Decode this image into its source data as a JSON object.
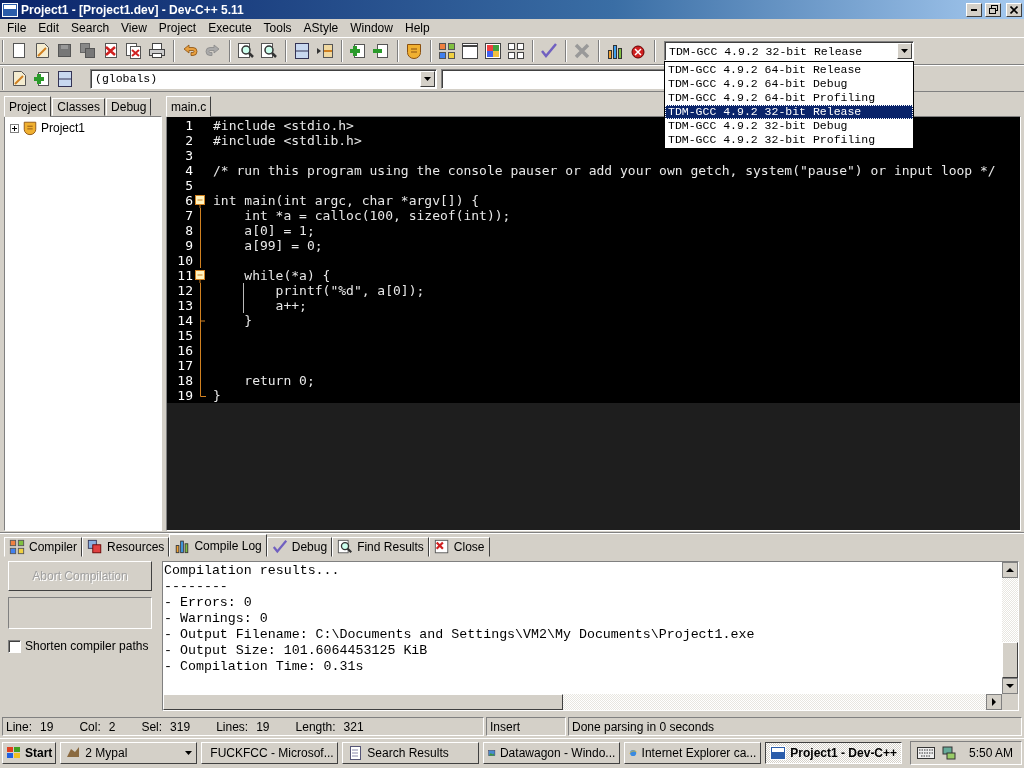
{
  "window": {
    "title": "Project1 - [Project1.dev] - Dev-C++ 5.11"
  },
  "menu": [
    "File",
    "Edit",
    "Search",
    "View",
    "Project",
    "Execute",
    "Tools",
    "AStyle",
    "Window",
    "Help"
  ],
  "compiler_select": {
    "value": "TDM-GCC 4.9.2 32-bit Release",
    "expanded": true,
    "options": [
      {
        "label": "TDM-GCC 4.9.2 64-bit Release",
        "selected": false
      },
      {
        "label": "TDM-GCC 4.9.2 64-bit Debug",
        "selected": false
      },
      {
        "label": "TDM-GCC 4.9.2 64-bit Profiling",
        "selected": false
      },
      {
        "label": "TDM-GCC 4.9.2 32-bit Release",
        "selected": true
      },
      {
        "label": "TDM-GCC 4.9.2 32-bit Debug",
        "selected": false
      },
      {
        "label": "TDM-GCC 4.9.2 32-bit Profiling",
        "selected": false
      }
    ]
  },
  "scope_select": {
    "value": "(globals)"
  },
  "side_tabs": [
    {
      "label": "Project",
      "selected": true
    },
    {
      "label": "Classes",
      "selected": false
    },
    {
      "label": "Debug",
      "selected": false
    }
  ],
  "project_tree": [
    {
      "label": "Project1",
      "expanded": false
    }
  ],
  "editor_tabs": [
    {
      "label": "main.c",
      "selected": true
    }
  ],
  "code_lines": [
    {
      "number": "1",
      "text": "#include <stdio.h>",
      "kind": "plain"
    },
    {
      "number": "2",
      "text": "#include <stdlib.h>",
      "kind": "plain"
    },
    {
      "number": "3",
      "kind": "plain"
    },
    {
      "number": "4",
      "text": "/* run this program using the console pauser or add your own getch, system(\"pause\") or input loop */",
      "kind": "plain"
    },
    {
      "number": "5",
      "kind": "plain"
    },
    {
      "number": "6",
      "text": "int main(int argc, char *argv[]) {",
      "kind": "foldstart"
    },
    {
      "number": "7",
      "text": "    int *a = calloc(100, sizeof(int));",
      "kind": "foldbody"
    },
    {
      "number": "8",
      "text": "    a[0] = 1;",
      "kind": "foldbody"
    },
    {
      "number": "9",
      "text": "    a[99] = 0;",
      "kind": "foldbody"
    },
    {
      "number": "10",
      "kind": "foldbody"
    },
    {
      "number": "11",
      "text": "    while(*a) {",
      "kind": "foldstart"
    },
    {
      "number": "12",
      "text": "        printf(\"%d\", a[0]);",
      "kind": "foldbody",
      "guide": true
    },
    {
      "number": "13",
      "text": "        a++;",
      "kind": "foldbody",
      "guide": true
    },
    {
      "number": "14",
      "text": "    }",
      "kind": "foldtick"
    },
    {
      "number": "15",
      "kind": "foldbody"
    },
    {
      "number": "16",
      "kind": "foldbody"
    },
    {
      "number": "17",
      "kind": "foldbody"
    },
    {
      "number": "18",
      "text": "    return 0;",
      "kind": "foldbody"
    },
    {
      "number": "19",
      "text": "}",
      "kind": "foldend"
    }
  ],
  "bottom_tabs": [
    {
      "label": "Compiler",
      "selected": false,
      "kind": "grid"
    },
    {
      "label": "Resources",
      "selected": false,
      "kind": "layers"
    },
    {
      "label": "Compile Log",
      "selected": true,
      "kind": "chart"
    },
    {
      "label": "Debug",
      "selected": false,
      "kind": "check"
    },
    {
      "label": "Find Results",
      "selected": false,
      "kind": "find"
    },
    {
      "label": "Close",
      "selected": false,
      "kind": "close"
    }
  ],
  "compiler_panel": {
    "abort_button": {
      "label": "Abort Compilation",
      "disabled": true
    },
    "shorten_paths": {
      "label": "Shorten compiler paths",
      "checked": false
    }
  },
  "compile_log": [
    "Compilation results...",
    "--------",
    "- Errors: 0",
    "- Warnings: 0",
    "- Output Filename: C:\\Documents and Settings\\VM2\\My Documents\\Project1.exe",
    "- Output Size: 101.6064453125 KiB",
    "- Compilation Time: 0.31s"
  ],
  "status_bar": {
    "fields": [
      {
        "label": "Line:",
        "value": "19"
      },
      {
        "label": "Col:",
        "value": "2"
      },
      {
        "label": "Sel:",
        "value": "319"
      },
      {
        "label": "Lines:",
        "value": "19"
      },
      {
        "label": "Length:",
        "value": "321"
      }
    ],
    "mode": "Insert",
    "message": "Done parsing in 0 seconds"
  },
  "taskbar": {
    "start": "Start",
    "items": [
      {
        "label": "2 Mypal",
        "selected": false,
        "kind": "group"
      },
      {
        "label": "FUCKFCC - Microsof...",
        "selected": false,
        "kind": "app"
      },
      {
        "label": "Search Results",
        "selected": false,
        "kind": "search"
      },
      {
        "label": "Datawagon - Windo...",
        "selected": false,
        "kind": "image"
      },
      {
        "label": "Internet Explorer ca...",
        "selected": false,
        "kind": "browser"
      },
      {
        "label": "Project1 - Dev-C++",
        "selected": true,
        "kind": "devcpp"
      }
    ],
    "clock": "5:50 AM"
  }
}
